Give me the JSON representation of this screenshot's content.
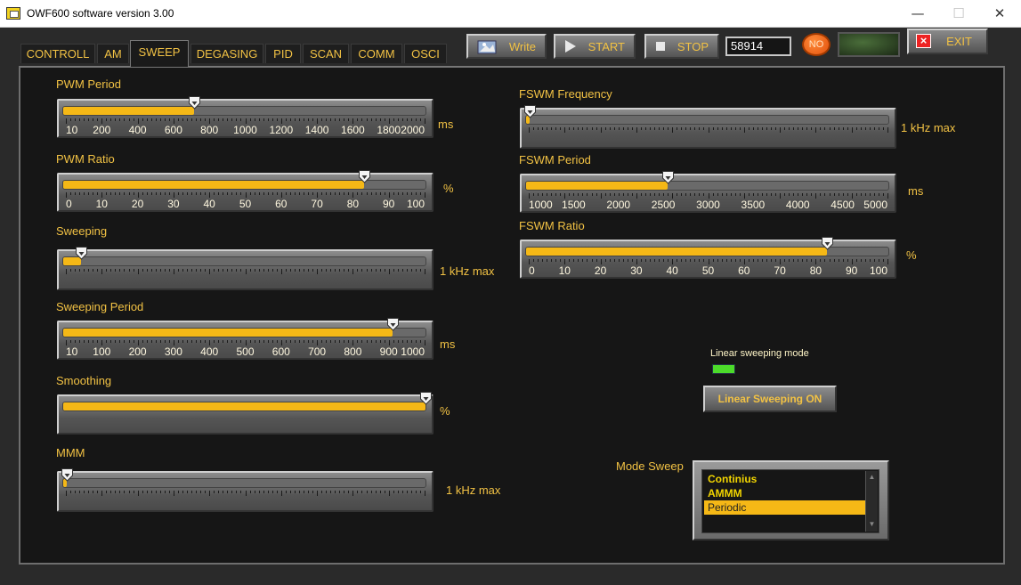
{
  "window": {
    "title": "OWF600 software version 3.00",
    "minimize": "—",
    "maximize": "☐",
    "close": "✕"
  },
  "tabs": [
    "CONTROLL",
    "AM",
    "SWEEP",
    "DEGASING",
    "PID",
    "SCAN",
    "COMM",
    "OSCI"
  ],
  "active_tab": "SWEEP",
  "toolbar": {
    "write_label": "Write",
    "start_label": "START",
    "stop_label": "STOP",
    "counter": "58914",
    "no_indicator": "NO",
    "exit_label": "EXIT"
  },
  "sliders": {
    "pwm_period": {
      "label": "PWM Period",
      "unit": "ms",
      "ticks": [
        "10",
        "200",
        "400",
        "600",
        "800",
        "1000",
        "1200",
        "1400",
        "1600",
        "1800",
        "2000"
      ],
      "value_fraction": 0.36
    },
    "pwm_ratio": {
      "label": "PWM Ratio",
      "unit": "%",
      "ticks": [
        "0",
        "10",
        "20",
        "30",
        "40",
        "50",
        "60",
        "70",
        "80",
        "90",
        "100"
      ],
      "value_fraction": 0.83
    },
    "sweeping": {
      "label": "Sweeping",
      "unit": "1 kHz max",
      "ticks": [],
      "value_fraction": 0.05
    },
    "sweeping_period": {
      "label": "Sweeping Period",
      "unit": "ms",
      "ticks": [
        "10",
        "100",
        "200",
        "300",
        "400",
        "500",
        "600",
        "700",
        "800",
        "900",
        "1000"
      ],
      "value_fraction": 0.91
    },
    "smoothing": {
      "label": "Smoothing",
      "unit": "%",
      "ticks": [],
      "value_fraction": 1.0
    },
    "mmm": {
      "label": "MMM",
      "unit": "1 kHz max",
      "ticks": [],
      "value_fraction": 0.01
    },
    "fswm_frequency": {
      "label": "FSWM Frequency",
      "unit": "1 kHz max",
      "ticks": [],
      "value_fraction": 0.01
    },
    "fswm_period": {
      "label": "FSWM Period",
      "unit": "ms",
      "ticks": [
        "1000",
        "1500",
        "2000",
        "2500",
        "3000",
        "3500",
        "4000",
        "4500",
        "5000"
      ],
      "value_fraction": 0.39
    },
    "fswm_ratio": {
      "label": "FSWM Ratio",
      "unit": "%",
      "ticks": [
        "0",
        "10",
        "20",
        "30",
        "40",
        "50",
        "60",
        "70",
        "80",
        "90",
        "100"
      ],
      "value_fraction": 0.83
    }
  },
  "linear": {
    "label": "Linear sweeping mode",
    "button": "Linear Sweeping ON",
    "led_color": "#4cdb2a"
  },
  "mode_sweep": {
    "label": "Mode Sweep",
    "options": [
      "Continius",
      "AMMM",
      "Periodic"
    ],
    "selected": "Periodic"
  },
  "colors": {
    "accent": "#f2c244",
    "fill": "#f5b816",
    "panel": "#161616"
  }
}
